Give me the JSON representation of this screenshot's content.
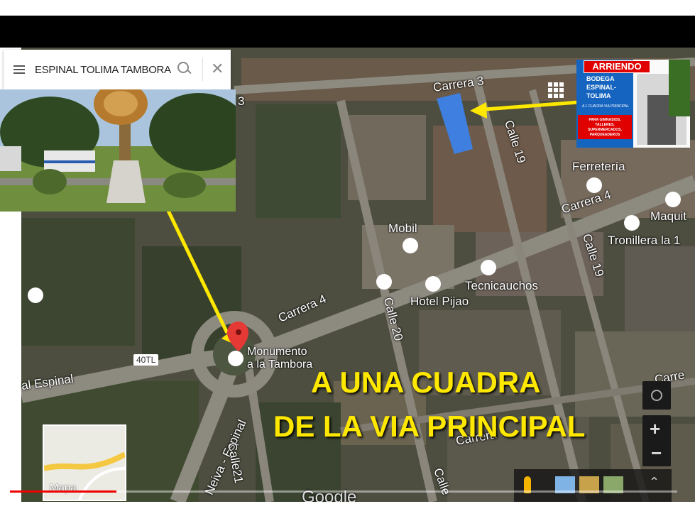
{
  "search": {
    "query": "ESPINAL TOLIMA TAMBORA"
  },
  "streets": {
    "carrera3": "Carrera 3",
    "carrera4_top": "Carrera 4",
    "carrera4_mid": "Carrera 4",
    "calle19_top": "Calle 19",
    "calle19_mid": "Calle 19",
    "calle20": "Calle 20",
    "calle21": "Calle21",
    "neiva_espinal": "Neiva - Espinal",
    "al_espinal": "al Espinal",
    "ruta": "40TL",
    "carrera_bottom": "Carrera",
    "carre_right": "Carre",
    "calle_bottom": "Calle",
    "num3": "3"
  },
  "places": {
    "ferreteria": "Ferretería",
    "maquit": "Maquit",
    "tronillera": "Tronillera la 1",
    "mobil": "Mobil",
    "tecnicauchos": "Tecnicauchos",
    "hotel": "Hotel Pijao",
    "monumento_l1": "Monumento",
    "monumento_l2": "a la Tambora"
  },
  "ad": {
    "header": "ARRIENDO",
    "line1": "BODEGA",
    "line2": "ESPINAL-",
    "line3": "TOLIMA",
    "small1": "A 1 CUADRA VIA PRINCIPAL",
    "small2": "PARA GIMNASIOS, TALLERES, SUPERMERCADOS, PARQUEADEROS"
  },
  "overlay": {
    "line1": "A UNA CUADRA",
    "line2": "DE LA VIA PRINCIPAL"
  },
  "minimap": {
    "label": "Mapa"
  },
  "watermark": "Google",
  "video": {
    "progress": 0.16
  },
  "colors": {
    "highlight": "#ffe800",
    "building": "#3f7fe0",
    "pin": "#e53935",
    "ad_header": "#e00000",
    "ad_blue": "#1565c0"
  }
}
